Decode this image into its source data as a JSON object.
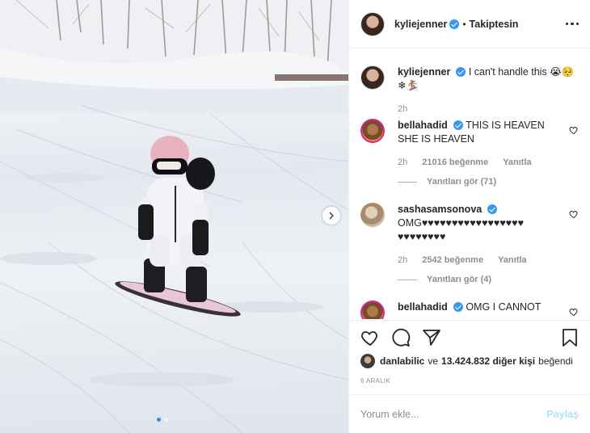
{
  "post": {
    "author": "kyliejenner",
    "follow_status": "Takiptesin",
    "caption": "I can't handle this 😭🥺",
    "caption_line2": "❄🏂",
    "caption_time": "2h"
  },
  "comments": [
    {
      "user": "bellahadid",
      "lines": [
        "THIS IS HEAVEN",
        "SHE IS HEAVEN"
      ],
      "time": "2h",
      "likes": "21016 beğenme",
      "reply": "Yanıtla",
      "view_replies": "Yanıtları gör (71)"
    },
    {
      "user": "sashasamsonova",
      "lines": [
        "OMG♥♥♥♥♥♥♥♥♥♥♥♥♥♥♥♥♥",
        "♥♥♥♥♥♥♥♥"
      ],
      "time": "2h",
      "likes": "2542 beğenme",
      "reply": "Yanıtla",
      "view_replies": "Yanıtları gör (4)"
    },
    {
      "user": "bellahadid",
      "lines": [
        "OMG I CANNOT"
      ]
    }
  ],
  "likes": {
    "user": "danlabilic",
    "connector": "ve",
    "count": "13.424.832 diğer kişi",
    "suffix": "beğendi"
  },
  "date": "6 ARALIK",
  "comment_box": {
    "placeholder": "Yorum ekle...",
    "share_label": "Paylaş"
  },
  "icons": {
    "like": "heart-icon",
    "comment": "comment-icon",
    "share": "paper-plane-icon",
    "save": "bookmark-icon",
    "more": "more-options-icon",
    "next": "chevron-right-icon"
  },
  "colors": {
    "verified": "#3897f0",
    "share_disabled": "#b2dffc",
    "muted_text": "#8e8e8e"
  }
}
